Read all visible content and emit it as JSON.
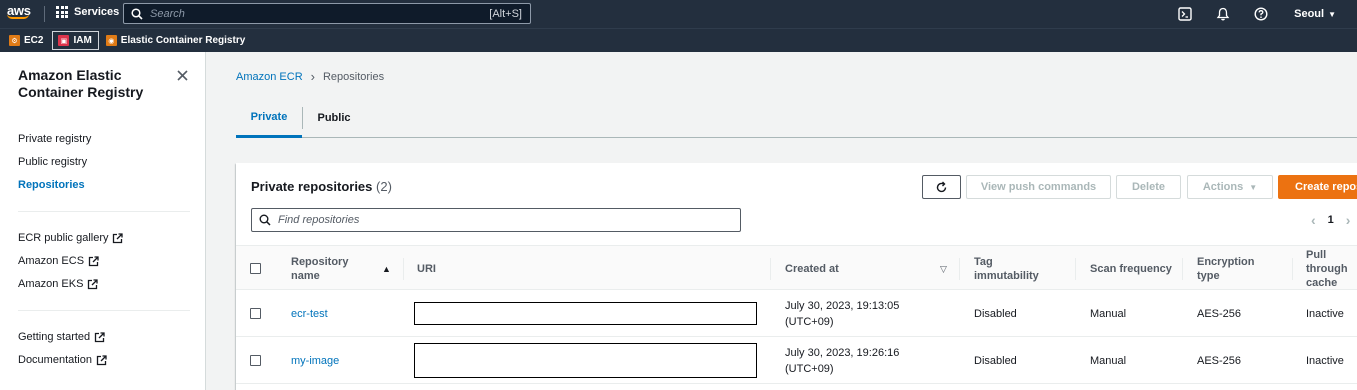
{
  "topnav": {
    "logo_text": "aws",
    "services_label": "Services",
    "search_placeholder": "Search",
    "search_shortcut": "[Alt+S]",
    "region": "Seoul"
  },
  "favorites": [
    {
      "label": "EC2",
      "color": "#e07b16"
    },
    {
      "label": "IAM",
      "color": "#dd344c"
    },
    {
      "label": "Elastic Container Registry",
      "color": "#e07b16"
    }
  ],
  "sidebar": {
    "title": "Amazon Elastic Container Registry",
    "items": [
      {
        "label": "Private registry"
      },
      {
        "label": "Public registry"
      },
      {
        "label": "Repositories",
        "active": true
      }
    ],
    "external_items": [
      {
        "label": "ECR public gallery"
      },
      {
        "label": "Amazon ECS"
      },
      {
        "label": "Amazon EKS"
      }
    ],
    "help_items": [
      {
        "label": "Getting started"
      },
      {
        "label": "Documentation"
      }
    ]
  },
  "breadcrumb": {
    "root": "Amazon ECR",
    "current": "Repositories"
  },
  "tabs": [
    {
      "label": "Private",
      "active": true
    },
    {
      "label": "Public"
    }
  ],
  "panel": {
    "title": "Private repositories",
    "count": "(2)",
    "buttons": {
      "push": "View push commands",
      "delete": "Delete",
      "actions": "Actions",
      "create": "Create repository"
    },
    "find_placeholder": "Find repositories",
    "page": "1"
  },
  "table": {
    "columns": {
      "name": "Repository name",
      "uri": "URI",
      "created": "Created at",
      "tag": "Tag immutability",
      "scan": "Scan frequency",
      "encryption": "Encryption type",
      "pull": "Pull through cache"
    },
    "rows": [
      {
        "name": "ecr-test",
        "created_date": "July 30, 2023, 19:13:05",
        "created_tz": "(UTC+09)",
        "tag": "Disabled",
        "scan": "Manual",
        "encryption": "AES-256",
        "pull": "Inactive"
      },
      {
        "name": "my-image",
        "created_date": "July 30, 2023, 19:26:16",
        "created_tz": "(UTC+09)",
        "tag": "Disabled",
        "scan": "Manual",
        "encryption": "AES-256",
        "pull": "Inactive"
      }
    ]
  },
  "colors": {
    "nav_bg": "#232f3e",
    "link": "#0073bb",
    "primary_button": "#ec7211"
  }
}
